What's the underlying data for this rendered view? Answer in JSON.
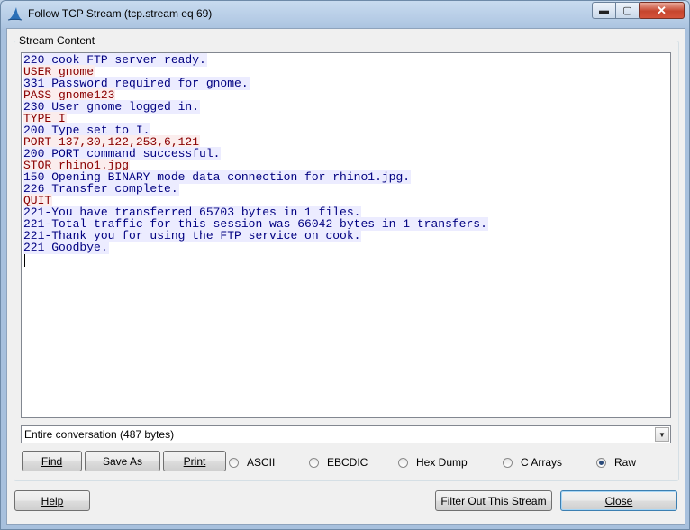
{
  "window": {
    "title": "Follow TCP Stream (tcp.stream eq 69)",
    "min_label": "▬",
    "max_label": "▢",
    "close_label": "✕"
  },
  "group": {
    "label": "Stream Content"
  },
  "stream_lines": [
    {
      "dir": "srv",
      "text": "220 cook FTP server ready."
    },
    {
      "dir": "cli",
      "text": "USER gnome"
    },
    {
      "dir": "srv",
      "text": "331 Password required for gnome."
    },
    {
      "dir": "cli",
      "text": "PASS gnome123"
    },
    {
      "dir": "srv",
      "text": "230 User gnome logged in."
    },
    {
      "dir": "cli",
      "text": "TYPE I"
    },
    {
      "dir": "srv",
      "text": "200 Type set to I."
    },
    {
      "dir": "cli",
      "text": "PORT 137,30,122,253,6,121"
    },
    {
      "dir": "srv",
      "text": "200 PORT command successful."
    },
    {
      "dir": "cli",
      "text": "STOR rhino1.jpg"
    },
    {
      "dir": "srv",
      "text": "150 Opening BINARY mode data connection for rhino1.jpg."
    },
    {
      "dir": "srv",
      "text": "226 Transfer complete."
    },
    {
      "dir": "cli",
      "text": "QUIT"
    },
    {
      "dir": "srv",
      "text": "221-You have transferred 65703 bytes in 1 files."
    },
    {
      "dir": "srv",
      "text": "221-Total traffic for this session was 66042 bytes in 1 transfers."
    },
    {
      "dir": "srv",
      "text": "221-Thank you for using the FTP service on cook."
    },
    {
      "dir": "srv",
      "text": "221 Goodbye."
    }
  ],
  "conversation_select": {
    "value": "Entire conversation (487 bytes)",
    "arrow": "▼"
  },
  "buttons": {
    "find": "Find",
    "save_as": "Save As",
    "print": "Print",
    "help": "Help",
    "filter_out": "Filter Out This Stream",
    "close": "Close"
  },
  "formats": {
    "ascii": "ASCII",
    "ebcdic": "EBCDIC",
    "hex_dump": "Hex Dump",
    "c_arrays": "C Arrays",
    "raw": "Raw",
    "selected": "raw"
  },
  "colors": {
    "server_text": "#000080",
    "server_bg": "#ececff",
    "client_text": "#8a0000",
    "client_bg": "#fbeded"
  }
}
